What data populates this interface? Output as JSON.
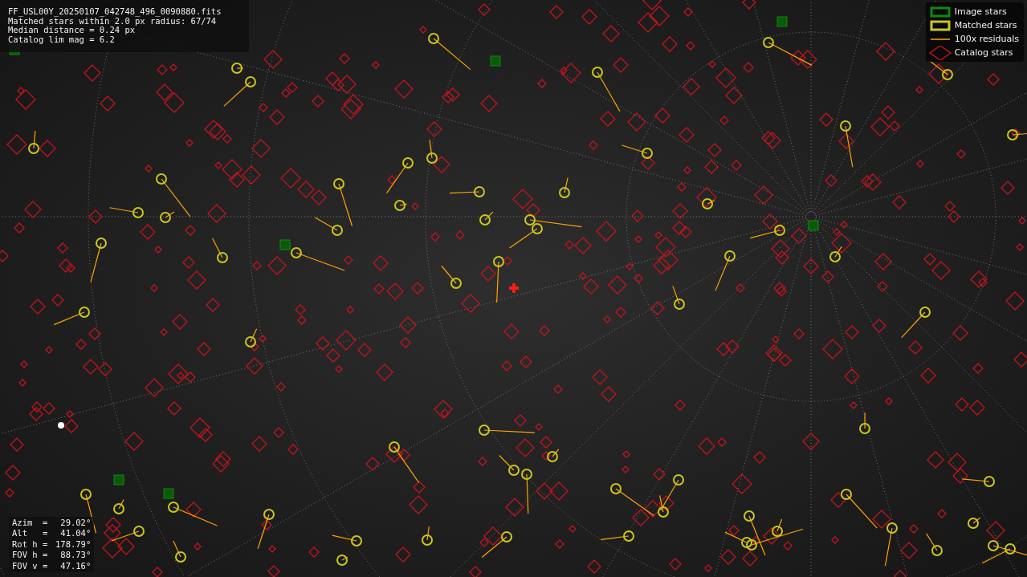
{
  "info_box": {
    "lines": [
      "FF_USL00Y_20250107_042748_496_0090880.fits",
      "Matched stars within 2.0 px radius: 67/74",
      "Median distance = 0.24 px",
      "Catalog lim mag = 6.2"
    ]
  },
  "legend": {
    "items": [
      {
        "kind": "image",
        "label": "Image stars"
      },
      {
        "kind": "matched",
        "label": "Matched stars"
      },
      {
        "kind": "residual",
        "label": "100x residuals"
      },
      {
        "kind": "catalog",
        "label": "Catalog stars"
      }
    ]
  },
  "pointing": {
    "rows": [
      {
        "label": "Azim  =",
        "value": "29.02°"
      },
      {
        "label": "Alt   =",
        "value": "41.04°"
      },
      {
        "label": "Rot h =",
        "value": "178.79°"
      },
      {
        "label": "FOV h =",
        "value": "88.73°"
      },
      {
        "label": "FOV v =",
        "value": "47.16°"
      }
    ]
  }
}
